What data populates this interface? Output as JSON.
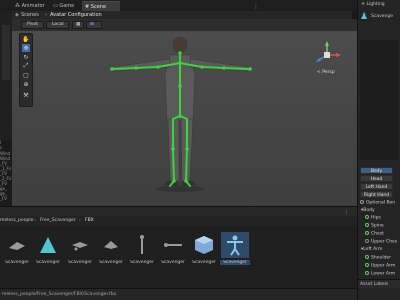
{
  "tabs": [
    {
      "label": "Animator",
      "active": false
    },
    {
      "label": "Game",
      "active": false
    },
    {
      "label": "Scene",
      "active": true
    }
  ],
  "breadcrumb": {
    "scenes": "Scenes",
    "current": "Avatar Configuration"
  },
  "scene_toolbar": {
    "pivot": "Pivot",
    "local": "Local"
  },
  "gizmo": {
    "label": "< Persp"
  },
  "left_strip_rows": [
    "l",
    "c",
    "Wind",
    "Wind",
    "_FV",
    "_1_Fir",
    "_FV",
    "_2_Fir",
    "_FV",
    "ge_",
    "ge_",
    "_FV"
  ],
  "project": {
    "path": [
      "meless_people",
      "Free_Scavenger",
      "FBX"
    ],
    "assets": [
      {
        "label": "Scavenger",
        "icon": "mesh-icon",
        "selected": false
      },
      {
        "label": "Scavenger",
        "icon": "triangle-icon",
        "selected": false
      },
      {
        "label": "Scavenger",
        "icon": "anim-icon",
        "selected": false
      },
      {
        "label": "Scavenger",
        "icon": "anim-icon",
        "selected": false
      },
      {
        "label": "Scavenger",
        "icon": "walk-icon",
        "selected": false
      },
      {
        "label": "Scavenger",
        "icon": "anim-icon",
        "selected": false
      },
      {
        "label": "Scavenger",
        "icon": "model-icon",
        "selected": false
      },
      {
        "label": "Scavenger",
        "icon": "avatar-icon",
        "selected": true
      }
    ],
    "status_path": "meless_people/Free_Scavenger/FBX/Scavenger.fbx"
  },
  "inspector": {
    "tab_label": "Lighting",
    "object_name": "Scavenge",
    "body_buttons": [
      {
        "label": "Body",
        "active": true
      },
      {
        "label": "Head",
        "active": false
      },
      {
        "label": "Left Hand",
        "active": false
      },
      {
        "label": "Right Hand",
        "active": false
      }
    ],
    "optional_bone": "Optional Bon",
    "tree": [
      {
        "label": "Body",
        "indent": 0,
        "check": false
      },
      {
        "label": "Hips",
        "indent": 1,
        "check": true
      },
      {
        "label": "Spine",
        "indent": 1,
        "check": true
      },
      {
        "label": "Chest",
        "indent": 1,
        "check": true
      },
      {
        "label": "Upper Ches",
        "indent": 1,
        "check": false
      },
      {
        "label": "Left Arm",
        "indent": 0,
        "check": false
      },
      {
        "label": "Shoulder",
        "indent": 1,
        "check": true
      },
      {
        "label": "Upper Arm",
        "indent": 1,
        "check": true
      },
      {
        "label": "Lower Arm",
        "indent": 1,
        "check": true
      }
    ],
    "asset_labels": "Asset Labels"
  },
  "colors": {
    "accent": "#2e4a6b",
    "bone": "#3cd43c",
    "blue_btn": "#3b5f86"
  }
}
